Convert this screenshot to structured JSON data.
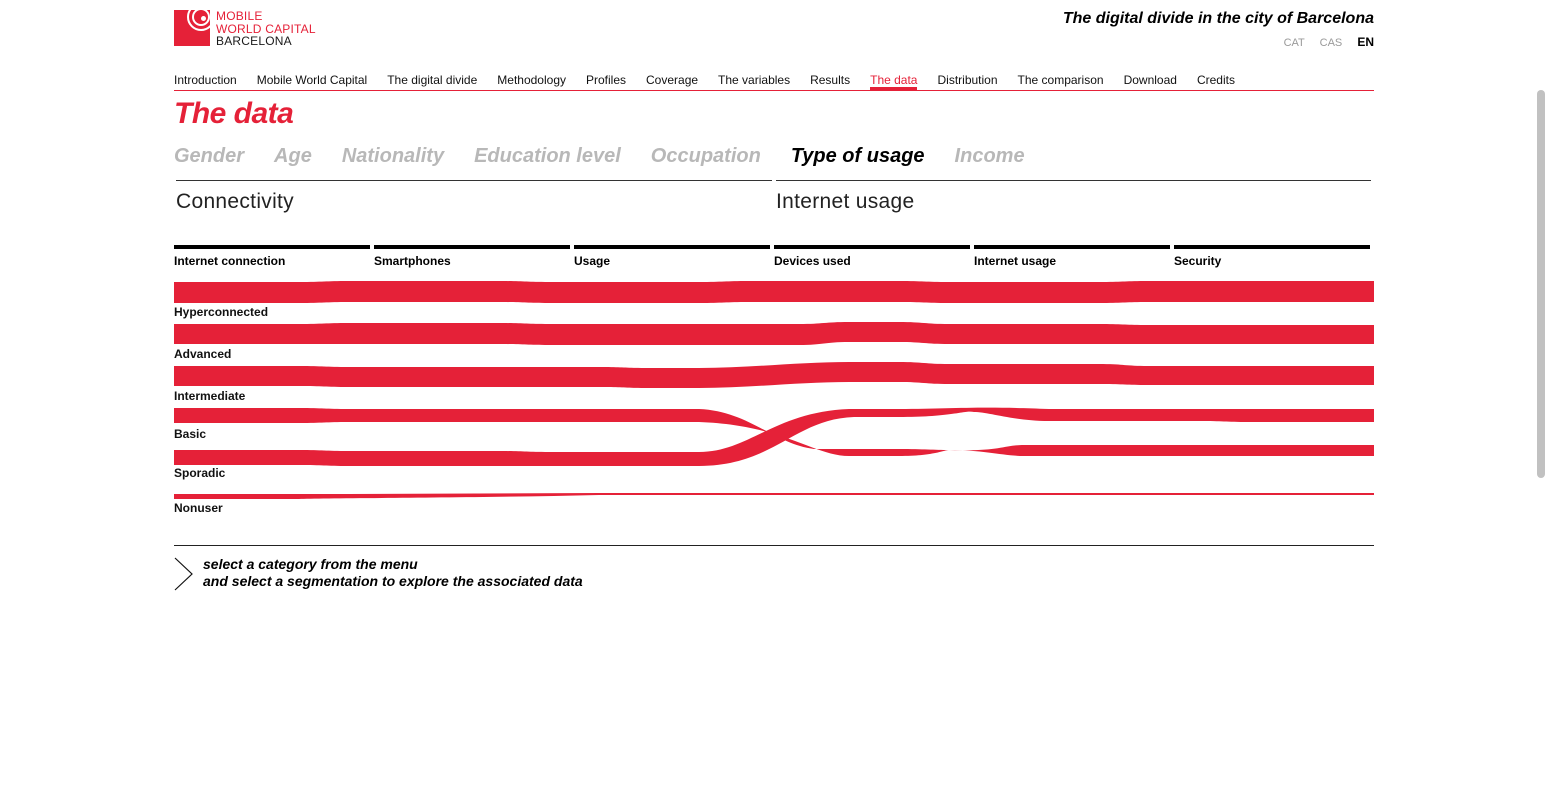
{
  "header": {
    "logo_line1": "MOBILE",
    "logo_line2": "WORLD CAPITAL",
    "logo_line3": "BARCELONA",
    "site_title": "The digital divide in the city of Barcelona",
    "languages": [
      "CAT",
      "CAS",
      "EN"
    ],
    "active_language": "EN"
  },
  "nav": {
    "items": [
      "Introduction",
      "Mobile World Capital",
      "The digital divide",
      "Methodology",
      "Profiles",
      "Coverage",
      "The variables",
      "Results",
      "The data",
      "Distribution",
      "The comparison",
      "Download",
      "Credits"
    ],
    "active": "The data"
  },
  "page_title": "The data",
  "categories": {
    "items": [
      "Gender",
      "Age",
      "Nationality",
      "Education level",
      "Occupation",
      "Type of usage",
      "Income"
    ],
    "active": "Type of usage"
  },
  "sections": [
    "Connectivity",
    "Internet usage"
  ],
  "columns": [
    "Internet connection",
    "Smartphones",
    "Usage",
    "Devices used",
    "Internet usage",
    "Security"
  ],
  "rows": [
    "Hyperconnected",
    "Advanced",
    "Intermediate",
    "Basic",
    "Sporadic",
    "Nonuser"
  ],
  "hint": {
    "line1": "select a category from the menu",
    "line2": "and select a segmentation to explore the associated data"
  },
  "colors": {
    "accent": "#e52138",
    "inactive": "#b8b8b8"
  }
}
